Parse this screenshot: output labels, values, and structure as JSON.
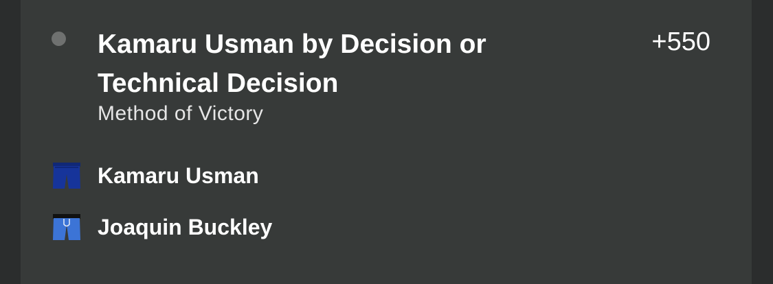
{
  "selection": {
    "title": "Kamaru Usman by Decision or Technical Decision",
    "odds": "+550",
    "market": "Method of Victory"
  },
  "fighters": [
    {
      "name": "Kamaru Usman",
      "icon": "dark-blue-trunks-icon",
      "trunks_color": "#16349a"
    },
    {
      "name": "Joaquin Buckley",
      "icon": "light-blue-trunks-icon",
      "trunks_color": "#3c74d6"
    }
  ],
  "colors": {
    "background": "#2b2d2d",
    "card": "#373a39",
    "status_dot": "#6f7170",
    "text": "#ffffff"
  }
}
